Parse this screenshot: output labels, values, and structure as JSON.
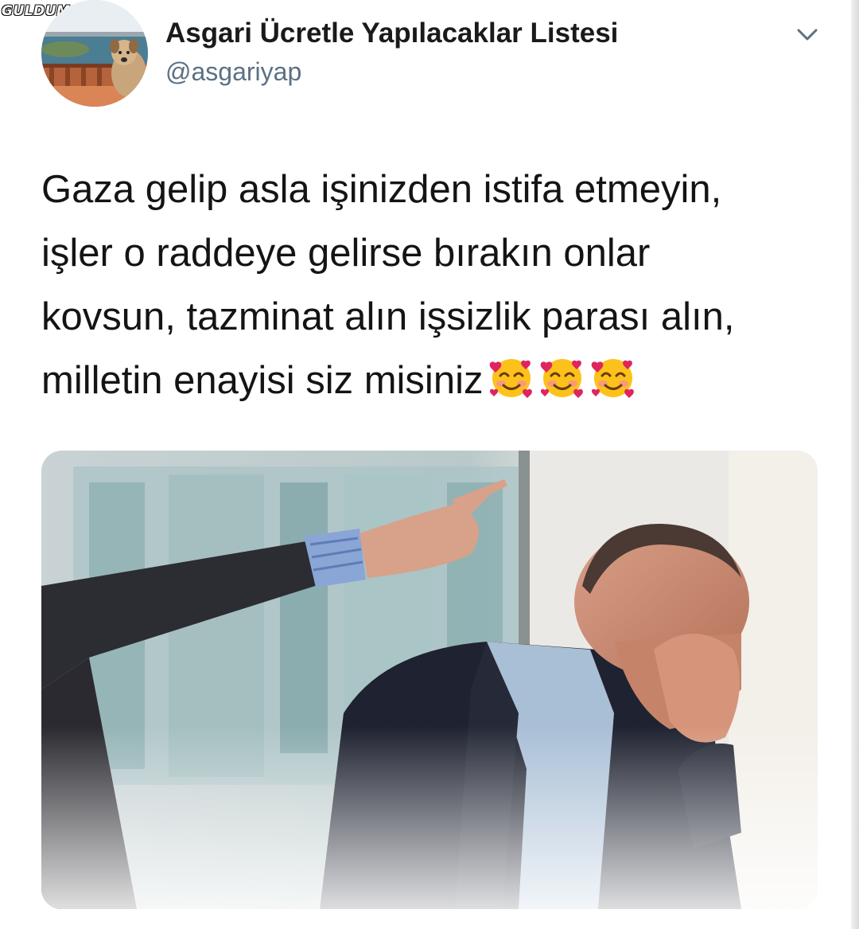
{
  "watermark": "GULDUM.NET",
  "tweet": {
    "author_name": "Asgari Ücretle Yapılacaklar Listesi",
    "author_handle": "@asgariyap",
    "text_lines": [
      "Gaza gelip asla işinizden istifa etmeyin,",
      "işler o raddeye gelirse bırakın onlar",
      "kovsun, tazminat alın işsizlik parası alın,",
      "milletin enayisi siz misiniz"
    ],
    "trailing_emoji": [
      "smiling-face-with-hearts",
      "smiling-face-with-hearts",
      "smiling-face-with-hearts"
    ],
    "menu_icon": "chevron-down-icon",
    "avatar_icon": "dog-on-balcony-photo",
    "media_icon": "office-man-being-fired-photo"
  },
  "colors": {
    "name": "#1a1a1a",
    "handle": "#5b7083",
    "text": "#141414",
    "chevron": "#5b7083"
  }
}
